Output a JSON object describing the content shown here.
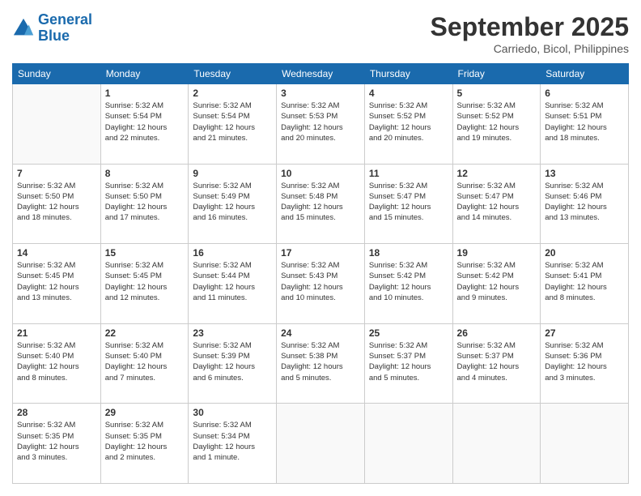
{
  "header": {
    "logo_line1": "General",
    "logo_line2": "Blue",
    "month": "September 2025",
    "location": "Carriedo, Bicol, Philippines"
  },
  "weekdays": [
    "Sunday",
    "Monday",
    "Tuesday",
    "Wednesday",
    "Thursday",
    "Friday",
    "Saturday"
  ],
  "weeks": [
    [
      {
        "day": "",
        "info": ""
      },
      {
        "day": "1",
        "info": "Sunrise: 5:32 AM\nSunset: 5:54 PM\nDaylight: 12 hours\nand 22 minutes."
      },
      {
        "day": "2",
        "info": "Sunrise: 5:32 AM\nSunset: 5:54 PM\nDaylight: 12 hours\nand 21 minutes."
      },
      {
        "day": "3",
        "info": "Sunrise: 5:32 AM\nSunset: 5:53 PM\nDaylight: 12 hours\nand 20 minutes."
      },
      {
        "day": "4",
        "info": "Sunrise: 5:32 AM\nSunset: 5:52 PM\nDaylight: 12 hours\nand 20 minutes."
      },
      {
        "day": "5",
        "info": "Sunrise: 5:32 AM\nSunset: 5:52 PM\nDaylight: 12 hours\nand 19 minutes."
      },
      {
        "day": "6",
        "info": "Sunrise: 5:32 AM\nSunset: 5:51 PM\nDaylight: 12 hours\nand 18 minutes."
      }
    ],
    [
      {
        "day": "7",
        "info": "Sunrise: 5:32 AM\nSunset: 5:50 PM\nDaylight: 12 hours\nand 18 minutes."
      },
      {
        "day": "8",
        "info": "Sunrise: 5:32 AM\nSunset: 5:50 PM\nDaylight: 12 hours\nand 17 minutes."
      },
      {
        "day": "9",
        "info": "Sunrise: 5:32 AM\nSunset: 5:49 PM\nDaylight: 12 hours\nand 16 minutes."
      },
      {
        "day": "10",
        "info": "Sunrise: 5:32 AM\nSunset: 5:48 PM\nDaylight: 12 hours\nand 15 minutes."
      },
      {
        "day": "11",
        "info": "Sunrise: 5:32 AM\nSunset: 5:47 PM\nDaylight: 12 hours\nand 15 minutes."
      },
      {
        "day": "12",
        "info": "Sunrise: 5:32 AM\nSunset: 5:47 PM\nDaylight: 12 hours\nand 14 minutes."
      },
      {
        "day": "13",
        "info": "Sunrise: 5:32 AM\nSunset: 5:46 PM\nDaylight: 12 hours\nand 13 minutes."
      }
    ],
    [
      {
        "day": "14",
        "info": "Sunrise: 5:32 AM\nSunset: 5:45 PM\nDaylight: 12 hours\nand 13 minutes."
      },
      {
        "day": "15",
        "info": "Sunrise: 5:32 AM\nSunset: 5:45 PM\nDaylight: 12 hours\nand 12 minutes."
      },
      {
        "day": "16",
        "info": "Sunrise: 5:32 AM\nSunset: 5:44 PM\nDaylight: 12 hours\nand 11 minutes."
      },
      {
        "day": "17",
        "info": "Sunrise: 5:32 AM\nSunset: 5:43 PM\nDaylight: 12 hours\nand 10 minutes."
      },
      {
        "day": "18",
        "info": "Sunrise: 5:32 AM\nSunset: 5:42 PM\nDaylight: 12 hours\nand 10 minutes."
      },
      {
        "day": "19",
        "info": "Sunrise: 5:32 AM\nSunset: 5:42 PM\nDaylight: 12 hours\nand 9 minutes."
      },
      {
        "day": "20",
        "info": "Sunrise: 5:32 AM\nSunset: 5:41 PM\nDaylight: 12 hours\nand 8 minutes."
      }
    ],
    [
      {
        "day": "21",
        "info": "Sunrise: 5:32 AM\nSunset: 5:40 PM\nDaylight: 12 hours\nand 8 minutes."
      },
      {
        "day": "22",
        "info": "Sunrise: 5:32 AM\nSunset: 5:40 PM\nDaylight: 12 hours\nand 7 minutes."
      },
      {
        "day": "23",
        "info": "Sunrise: 5:32 AM\nSunset: 5:39 PM\nDaylight: 12 hours\nand 6 minutes."
      },
      {
        "day": "24",
        "info": "Sunrise: 5:32 AM\nSunset: 5:38 PM\nDaylight: 12 hours\nand 5 minutes."
      },
      {
        "day": "25",
        "info": "Sunrise: 5:32 AM\nSunset: 5:37 PM\nDaylight: 12 hours\nand 5 minutes."
      },
      {
        "day": "26",
        "info": "Sunrise: 5:32 AM\nSunset: 5:37 PM\nDaylight: 12 hours\nand 4 minutes."
      },
      {
        "day": "27",
        "info": "Sunrise: 5:32 AM\nSunset: 5:36 PM\nDaylight: 12 hours\nand 3 minutes."
      }
    ],
    [
      {
        "day": "28",
        "info": "Sunrise: 5:32 AM\nSunset: 5:35 PM\nDaylight: 12 hours\nand 3 minutes."
      },
      {
        "day": "29",
        "info": "Sunrise: 5:32 AM\nSunset: 5:35 PM\nDaylight: 12 hours\nand 2 minutes."
      },
      {
        "day": "30",
        "info": "Sunrise: 5:32 AM\nSunset: 5:34 PM\nDaylight: 12 hours\nand 1 minute."
      },
      {
        "day": "",
        "info": ""
      },
      {
        "day": "",
        "info": ""
      },
      {
        "day": "",
        "info": ""
      },
      {
        "day": "",
        "info": ""
      }
    ]
  ]
}
